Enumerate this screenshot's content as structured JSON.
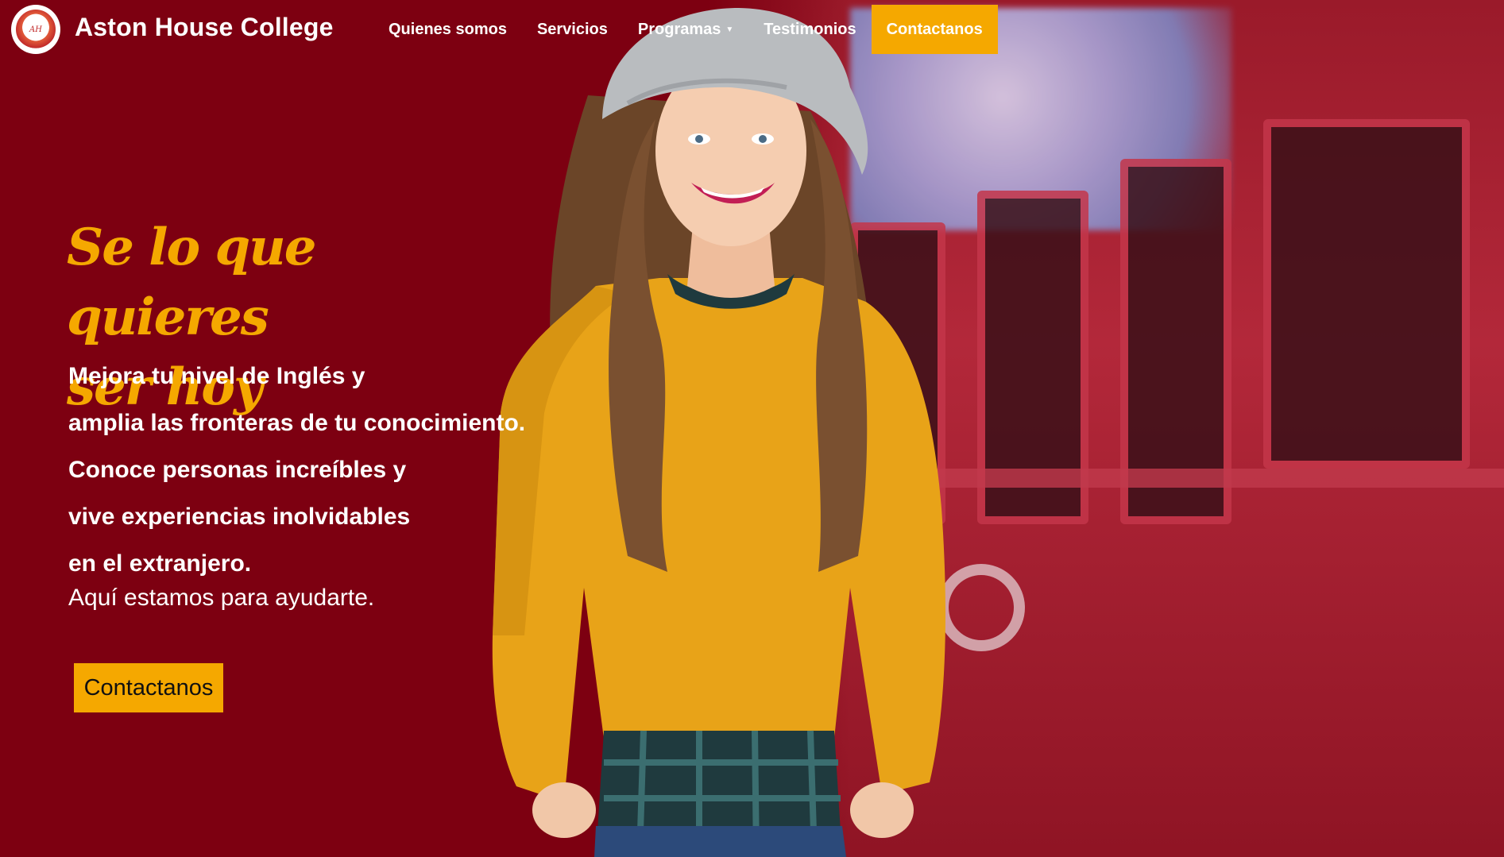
{
  "brand": {
    "name": "Aston House College",
    "logo": "aston-house-logo"
  },
  "nav": {
    "items": [
      {
        "label": "Quienes somos"
      },
      {
        "label": "Servicios"
      },
      {
        "label": "Programas",
        "icon": "caret-down-icon"
      },
      {
        "label": "Testimonios"
      }
    ],
    "cta_label": "Contactanos"
  },
  "hero": {
    "title_line1": "Se lo que quieres",
    "title_line2": "ser hoy",
    "lines": [
      "Mejora tu nivel de Inglés y",
      "amplia las fronteras de tu conocimiento.",
      "Conoce personas increíbles y",
      "vive experiencias inolvidables",
      "en el extranjero."
    ],
    "subline": "Aquí estamos para ayudarte.",
    "button_label": "Contactanos"
  },
  "colors": {
    "background": "#7d0011",
    "accent": "#f5a800",
    "text": "#ffffff"
  }
}
